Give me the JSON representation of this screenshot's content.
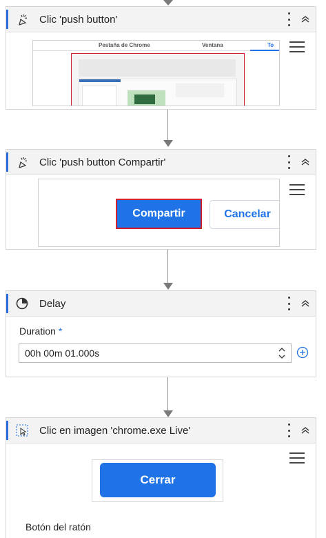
{
  "steps": [
    {
      "title": "Clic 'push button'",
      "icon": "cursor-click-icon",
      "thumbnail": {
        "tab_chrome": "Pestaña de Chrome",
        "tab_window": "Ventana",
        "tab_active": "To"
      }
    },
    {
      "title": "Clic 'push button  Compartir'",
      "icon": "cursor-click-icon",
      "preview": {
        "primary_label": "Compartir",
        "secondary_label": "Cancelar"
      }
    },
    {
      "title": "Delay",
      "icon": "clock-icon",
      "field": {
        "label": "Duration",
        "required_mark": "*",
        "value": "00h 00m 01.000s"
      }
    },
    {
      "title": "Clic en imagen 'chrome.exe Live'",
      "icon": "image-click-icon",
      "preview": {
        "primary_label": "Cerrar"
      },
      "field_label": "Botón del ratón"
    }
  ],
  "colors": {
    "accent": "#1f73e6",
    "header_bg": "#f3f3f3",
    "selection_red": "#d21f2a"
  }
}
